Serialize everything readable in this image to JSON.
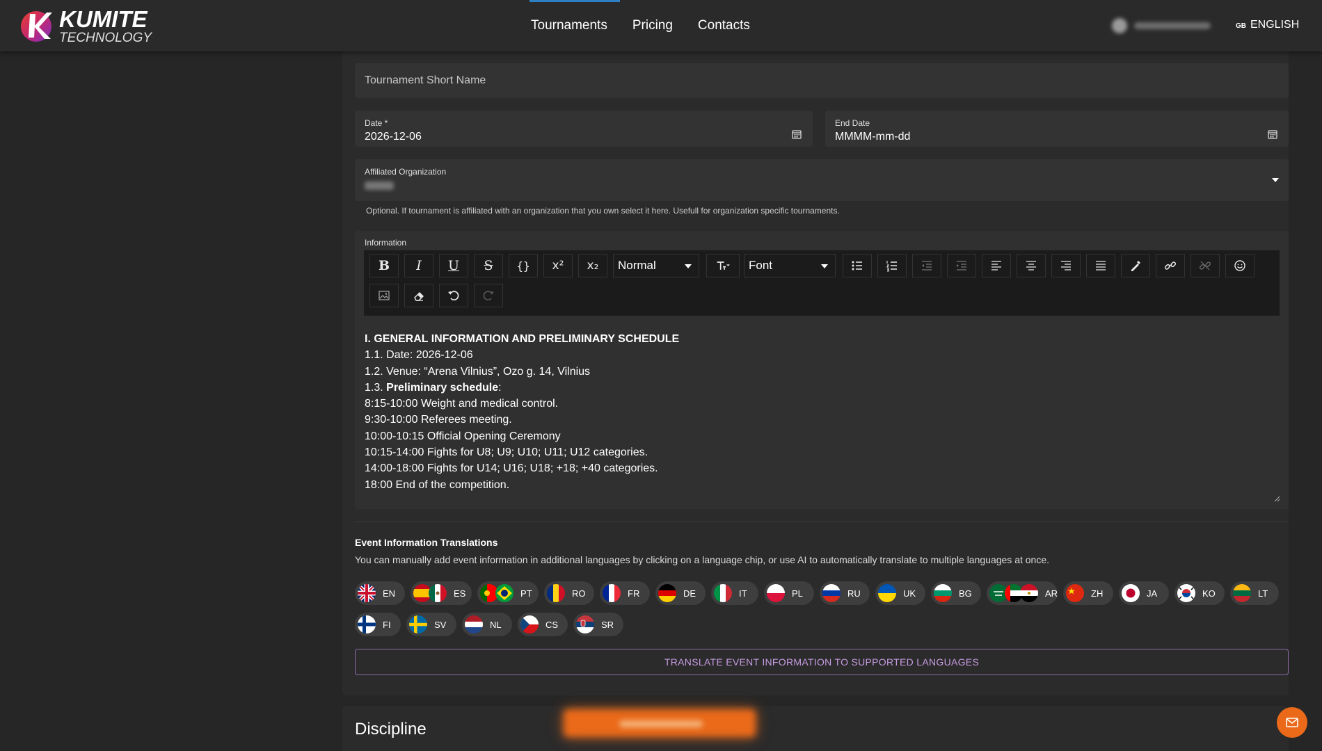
{
  "header": {
    "logo_main": "KUMITE",
    "logo_sub": "TECHNOLOGY",
    "nav": [
      "Tournaments",
      "Pricing",
      "Contacts"
    ],
    "active_nav": "Tournaments",
    "language_code": "GB",
    "language": "ENGLISH"
  },
  "form": {
    "short_name_placeholder": "Tournament Short Name",
    "date_label": "Date *",
    "date_value": "2026-12-06",
    "end_date_label": "End Date",
    "end_date_value": "MMMM-mm-dd",
    "org_label": "Affiliated Organization",
    "org_helper": "Optional. If tournament is affiliated with an organization that you own select it here. Usefull for organization specific tournaments."
  },
  "editor": {
    "label": "Information",
    "toolbar": {
      "bold": "B",
      "italic": "I",
      "underline": "U",
      "strike": "S",
      "code": "{}",
      "superscript": "x²",
      "subscript": "x₂",
      "block_format": "Normal",
      "font": "Font"
    },
    "content": {
      "heading": "I. GENERAL INFORMATION AND PRELIMINARY SCHEDULE",
      "line1": "1.1. Date: 2026-12-06",
      "line2": "1.2. Venue: “Arena Vilnius”, Ozo g. 14, Vilnius",
      "line3_prefix": "1.3. ",
      "line3_bold": "Preliminary schedule",
      "line3_suffix": ":",
      "line4": "8:15-10:00 Weight and medical control.",
      "line5": "9:30-10:00 Referees meeting.",
      "line6": "10:00-10:15 Official Opening Ceremony",
      "line7": "10:15-14:00 Fights for U8; U9; U10; U11; U12 categories.",
      "line8": "14:00-18:00 Fights for U14; U16; U18; +18; +40 categories.",
      "line9": "18:00 End of the competition."
    }
  },
  "translations": {
    "title": "Event Information Translations",
    "description": "You can manually add event information in additional languages by clicking on a language chip, or use AI to automatically translate to multiple languages at once.",
    "languages": [
      "EN",
      "ES",
      "PT",
      "RO",
      "FR",
      "DE",
      "IT",
      "PL",
      "RU",
      "UK",
      "BG",
      "AR",
      "ZH",
      "JA",
      "KO",
      "LT",
      "FI",
      "SV",
      "NL",
      "CS",
      "SR"
    ],
    "translate_button": "TRANSLATE EVENT INFORMATION TO SUPPORTED LANGUAGES"
  },
  "discipline": {
    "title": "Discipline"
  },
  "colors": {
    "background": "#262626",
    "card": "#2b2b2b",
    "accent_purple": "#c89de4",
    "accent_orange": "#ea6a1a",
    "nav_active": "#2f7fc4"
  },
  "icons": {
    "mail": "mail-icon",
    "calendar": "calendar-icon",
    "dropdown": "chevron-down-icon"
  }
}
